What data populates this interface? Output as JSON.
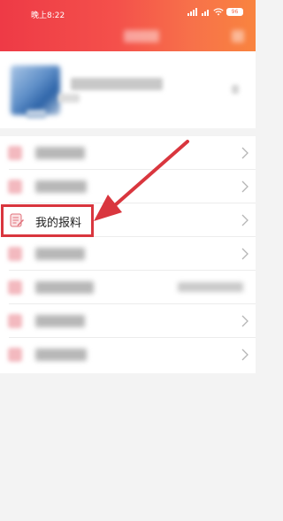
{
  "status_bar": {
    "time": "晚上8:22",
    "battery": "96"
  },
  "menu": {
    "items": [
      {
        "icon": "blurred-icon",
        "label": null,
        "chevron": true
      },
      {
        "icon": "blurred-icon",
        "label": null,
        "chevron": true
      },
      {
        "icon": "report-note-icon",
        "label": "我的报料",
        "chevron": true
      },
      {
        "icon": "blurred-icon",
        "label": null,
        "chevron": true
      },
      {
        "icon": "blurred-icon",
        "label": null,
        "chevron": false
      },
      {
        "icon": "blurred-icon",
        "label": null,
        "chevron": true
      },
      {
        "icon": "blurred-icon",
        "label": null,
        "chevron": true
      }
    ]
  },
  "annotation": {
    "highlight_color": "#d9363e"
  },
  "colors": {
    "header_start": "#ee3a46",
    "header_end": "#f9843f",
    "background": "#f3f3f3"
  }
}
